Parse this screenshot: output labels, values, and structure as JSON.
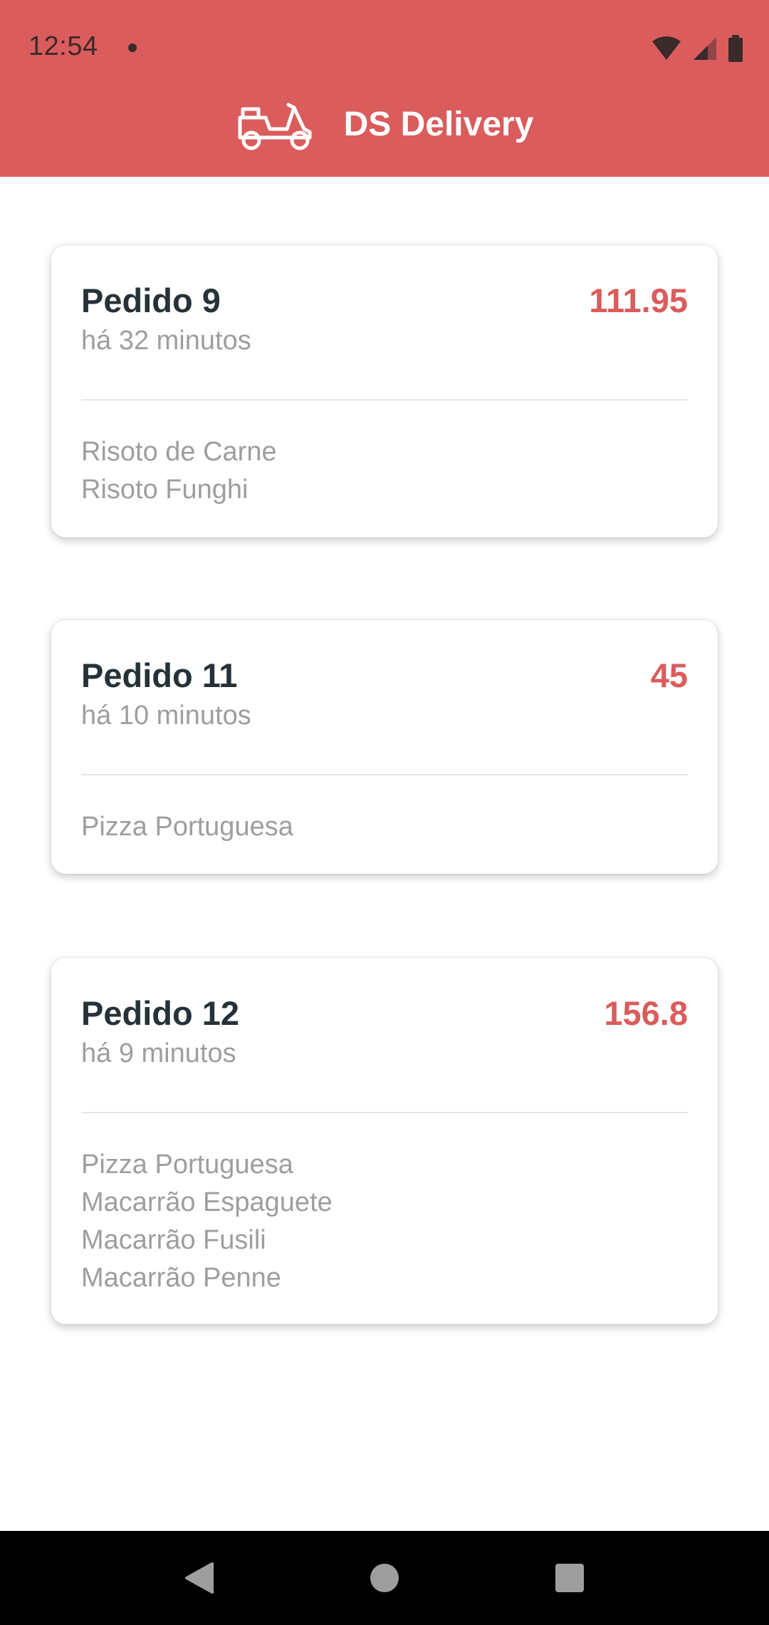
{
  "status_bar": {
    "time": "12:54"
  },
  "header": {
    "title": "DS Delivery",
    "logo_icon": "scooter-icon",
    "background_color": "#DA5C5C"
  },
  "orders": [
    {
      "title": "Pedido 9",
      "price": "111.95",
      "time_ago": "há 32 minutos",
      "items": [
        "Risoto de Carne",
        "Risoto Funghi"
      ]
    },
    {
      "title": "Pedido 11",
      "price": "45",
      "time_ago": "há 10 minutos",
      "items": [
        "Pizza Portuguesa"
      ]
    },
    {
      "title": "Pedido 12",
      "price": "156.8",
      "time_ago": "há 9 minutos",
      "items": [
        "Pizza Portuguesa",
        "Macarrão Espaguete",
        "Macarrão Fusili",
        "Macarrão Penne"
      ]
    }
  ],
  "nav_bar": {
    "back_icon": "back-triangle-icon",
    "home_icon": "home-circle-icon",
    "recents_icon": "recents-square-icon"
  }
}
